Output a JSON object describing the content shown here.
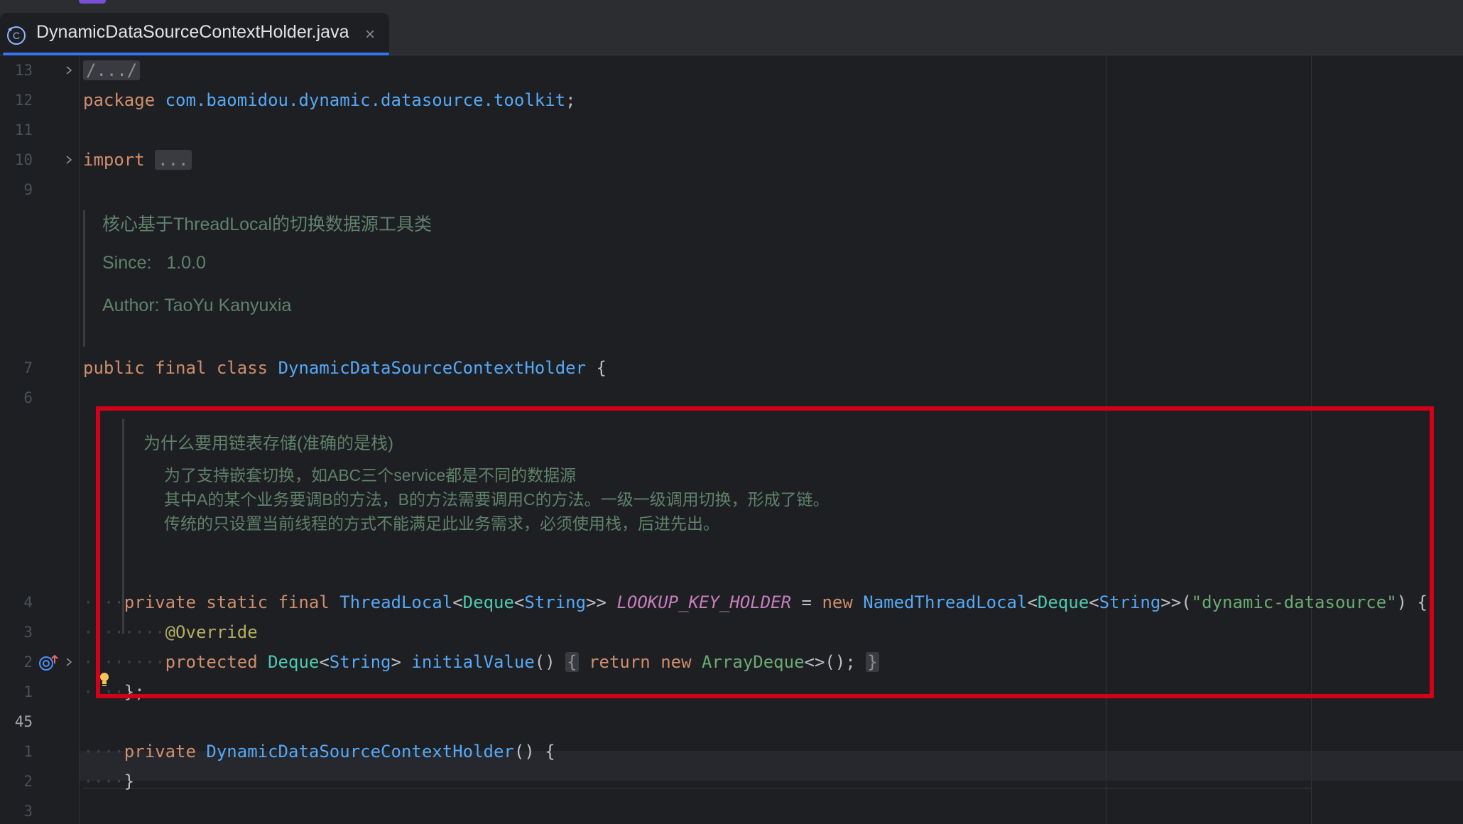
{
  "tab": {
    "file_name": "DynamicDataSourceContextHolder.java",
    "close_glyph": "×",
    "icon": "java-class-icon"
  },
  "gutter": {
    "lines": [
      "13",
      "12",
      "11",
      "10",
      "9",
      "7",
      "6",
      "4",
      "3",
      "2",
      "1",
      "45",
      "1",
      "2",
      "3"
    ]
  },
  "code": {
    "folded_header": "/.../",
    "package_kw": "package",
    "package_name": "com.baomidou.dynamic.datasource.toolkit",
    "semicolon": ";",
    "import_kw": "import",
    "import_folded": "...",
    "class_decl": {
      "public": "public",
      "final": "final",
      "class": "class",
      "name": "DynamicDataSourceContextHolder",
      "brace": "{"
    },
    "field_line": {
      "private": "private",
      "static": "static",
      "final": "final",
      "type1": "ThreadLocal",
      "lt1": "<",
      "type2": "Deque",
      "lt2": "<",
      "type3": "String",
      "gt": ">>",
      "field": "LOOKUP_KEY_HOLDER",
      "eq": "=",
      "new": "new",
      "impl": "NamedThreadLocal",
      "lt3": "<",
      "type4": "Deque",
      "lt4": "<",
      "type5": "String",
      "gt2": ">>(",
      "arg": "\"dynamic-datasource\"",
      "close": ") {"
    },
    "override": "@Override",
    "method_line": {
      "protected": "protected",
      "ret_type": "Deque",
      "lt": "<",
      "ret_gen": "String",
      "gt": ">",
      "name": "initialValue",
      "parens": "()",
      "open": "{",
      "return": "return",
      "new": "new",
      "impl": "ArrayDeque",
      "diamond": "<>();",
      "close": "}"
    },
    "end_anon": "};",
    "ctor_line": {
      "private": "private",
      "name": "DynamicDataSourceContextHolder",
      "rest": "() {"
    },
    "ctor_close": "}"
  },
  "doc1": {
    "summary": "核心基于ThreadLocal的切换数据源工具类",
    "since_label": "Since:",
    "since_value": "1.0.0",
    "author": "Author: TaoYu Kanyuxia"
  },
  "doc2": {
    "title": "为什么要用链表存储(准确的是栈)",
    "lines": [
      "为了支持嵌套切换，如ABC三个service都是不同的数据源",
      "其中A的某个业务要调B的方法，B的方法需要调用C的方法。一级一级调用切换，形成了链。",
      "传统的只设置当前线程的方式不能满足此业务需求，必须使用栈，后进先出。"
    ]
  },
  "colors": {
    "highlight_box": "#d4001a",
    "tab_underline": "#3574f0",
    "background": "#1e1f22"
  }
}
